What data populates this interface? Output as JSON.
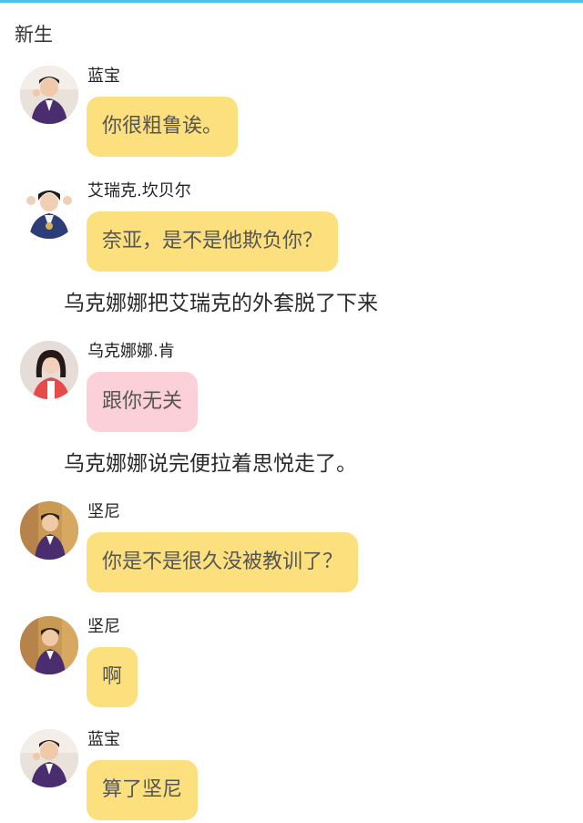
{
  "section_title": "新生",
  "colors": {
    "accent_rule": "#49c4e8",
    "bubble_yellow": "#fde07e",
    "bubble_pink": "#fbd0d8"
  },
  "messages": [
    {
      "speaker": "蓝宝",
      "text": "你很粗鲁诶。",
      "bubble": "yellow",
      "avatar": "avatar-lanbao"
    },
    {
      "speaker": "艾瑞克.坎贝尔",
      "text": "奈亚，是不是他欺负你？",
      "bubble": "yellow",
      "avatar": "avatar-eric"
    },
    {
      "narration": "乌克娜娜把艾瑞克的外套脱了下来"
    },
    {
      "speaker": "乌克娜娜.肯",
      "text": "跟你无关",
      "bubble": "pink",
      "avatar": "avatar-ukenana"
    },
    {
      "narration": "乌克娜娜说完便拉着思悦走了。"
    },
    {
      "speaker": "坚尼",
      "text": "你是不是很久没被教训了？",
      "bubble": "yellow",
      "avatar": "avatar-jianni"
    },
    {
      "speaker": "坚尼",
      "text": "啊",
      "bubble": "yellow",
      "avatar": "avatar-jianni"
    },
    {
      "speaker": "蓝宝",
      "text": "算了坚尼",
      "bubble": "yellow",
      "avatar": "avatar-lanbao"
    }
  ]
}
